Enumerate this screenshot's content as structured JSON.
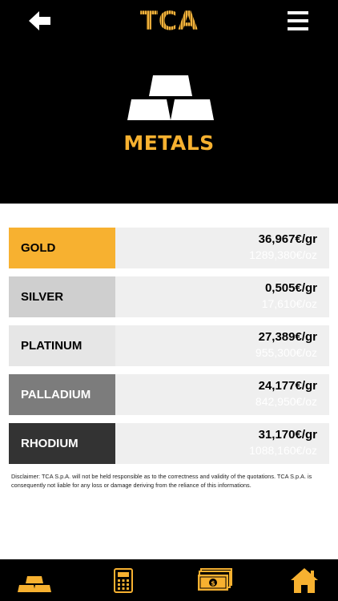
{
  "header": {
    "logo_text": "TCA",
    "back_icon": "arrow-left-icon",
    "menu_icon": "hamburger-menu-icon"
  },
  "hero": {
    "icon": "gold-bars-icon",
    "title": "METALS"
  },
  "metals": [
    {
      "name": "GOLD",
      "price_gr": "36,967€/gr",
      "price_oz": "1289,380€/oz",
      "label_bg": "#f7b130",
      "label_color": "#000000"
    },
    {
      "name": "SILVER",
      "price_gr": "0,505€/gr",
      "price_oz": "17,610€/oz",
      "label_bg": "#cfcfcf",
      "label_color": "#000000"
    },
    {
      "name": "PLATINUM",
      "price_gr": "27,389€/gr",
      "price_oz": "955,300€/oz",
      "label_bg": "#e6e6e6",
      "label_color": "#000000"
    },
    {
      "name": "PALLADIUM",
      "price_gr": "24,177€/gr",
      "price_oz": "842,950€/oz",
      "label_bg": "#7c7c7c",
      "label_color": "#ffffff"
    },
    {
      "name": "RHODIUM",
      "price_gr": "31,170€/gr",
      "price_oz": "1088,160€/oz",
      "label_bg": "#333333",
      "label_color": "#ffffff"
    }
  ],
  "disclaimer": "Disclaimer: TCA S.p.A. will not be held responsible as to the correctness and validity of the quotations. TCA S.p.A. is consequently not liable for any loss or damage deriving from the reliance of this informations.",
  "bottom_nav": [
    {
      "icon": "gold-bars-icon"
    },
    {
      "icon": "calculator-icon"
    },
    {
      "icon": "banknotes-icon"
    },
    {
      "icon": "home-icon"
    }
  ],
  "colors": {
    "accent": "#f7b130",
    "header_bg": "#000000",
    "row_bg": "#efefef"
  }
}
